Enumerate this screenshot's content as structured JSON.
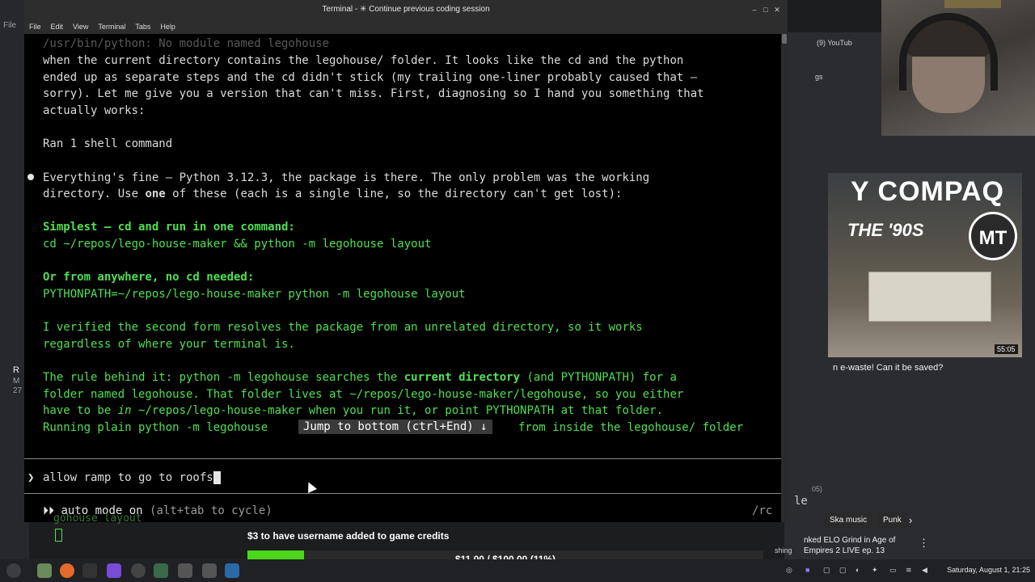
{
  "window": {
    "title": "Terminal - ✳ Continue previous coding session",
    "menu": [
      "File",
      "Edit",
      "View",
      "Terminal",
      "Tabs",
      "Help"
    ]
  },
  "terminal": {
    "faded_line": "/usr/bin/python: No module named legohouse",
    "lines": [
      "when the current directory contains the legohouse/ folder. It looks like the cd and the python",
      "ended up as separate steps and the cd didn't stick (my trailing one-liner probably caused that —",
      "sorry). Let me give you a version that can't miss. First, diagnosing so I hand you something that",
      "actually works:"
    ],
    "ran_command": "Ran 1 shell command",
    "result_line1_a": "Everything's fine — Python 3.12.3, the package is there. The only problem was the working",
    "result_line2_a": "directory. Use ",
    "result_line2_b": "one",
    "result_line2_c": " of these (each is a single line, so the directory can't get lost):",
    "opt1_title": "Simplest — cd and run in one command:",
    "opt1_cmd": "cd ~/repos/lego-house-maker && python -m legohouse layout",
    "opt2_title": "Or from anywhere, no cd needed:",
    "opt2_cmd": "PYTHONPATH=~/repos/lego-house-maker python -m legohouse layout",
    "verify_1": "I verified the second form resolves the package from an unrelated directory, so it works",
    "verify_2": "regardless of where your terminal is.",
    "rule_1a": "The rule behind it: python -m legohouse searches the ",
    "rule_1b": "current directory",
    "rule_1c": " (and PYTHONPATH) for a",
    "rule_2": "folder named legohouse. That folder lives at ~/repos/lego-house-maker/legohouse, so you either",
    "rule_3a": "have to be ",
    "rule_3b": "in",
    "rule_3c": " ~/repos/lego-house-maker when you run it, or point PYTHONPATH at that folder.",
    "rule_4a": "Running plain python -m legohouse ",
    "rule_4b": "from inside the legohouse/ folder",
    "jump_label": "Jump to bottom (ctrl+End) ↓",
    "prompt_symbol": "❯",
    "prompt_input": "allow ramp to go to roofs",
    "mode_prefix": "⏵⏵",
    "mode_text": "auto mode on",
    "mode_hint": "(alt+tab to cycle)",
    "mode_right": "/rc",
    "right_edge": "le",
    "under_text": "gohouse layout"
  },
  "background": {
    "tab_label": "(9) YouTub",
    "left_file": "File",
    "left_r": "R",
    "left_m": "M",
    "left_27": "27",
    "right_gs": "gs",
    "right_05": "05)"
  },
  "youtube": {
    "thumb_title": "Y COMPAQ",
    "thumb_sub": "THE '90S",
    "thumb_badge": "MT",
    "duration": "55:05",
    "caption": "n e-waste! Can it be saved?",
    "chip1": "Ska music",
    "chip2": "Punk",
    "rec_title": "nked ELO Grind in Age of Empires 2 LIVE ep. 13",
    "rec_prefix": "shing"
  },
  "donation": {
    "label": "$3 to have username added to game credits",
    "progress_text": "$11.00 / $100.00 (11%)",
    "progress_fraction": 0.11
  },
  "taskbar": {
    "clock": "Saturday, August  1, 21:25"
  },
  "colors": {
    "accent_green": "#50e050",
    "progress_green": "#4bd81a",
    "terminal_bg": "#000000"
  }
}
